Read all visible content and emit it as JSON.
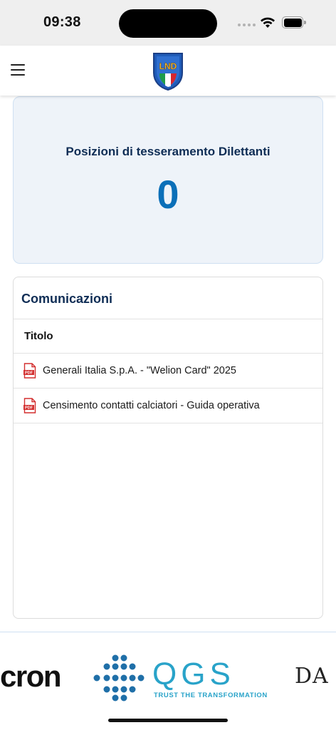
{
  "status_bar": {
    "time": "09:38"
  },
  "header": {
    "logo_text": "LND"
  },
  "stat_card": {
    "title": "Posizioni di tesseramento Dilettanti",
    "value": "0"
  },
  "communications": {
    "title": "Comunicazioni",
    "column_header": "Titolo",
    "items": [
      {
        "icon": "pdf-icon",
        "title": "Generali Italia S.p.A. - \"Welion Card\" 2025"
      },
      {
        "icon": "pdf-icon",
        "title": "Censimento contatti calciatori - Guida operativa"
      }
    ]
  },
  "sponsors": {
    "left_partial": "cron",
    "qgs_name": "QGS",
    "qgs_tagline": "TRUST THE TRANSFORMATION",
    "right_partial": "DA"
  },
  "colors": {
    "navy": "#0f2d55",
    "accent_blue": "#0b6fb8",
    "card_bg": "#eef3f9",
    "pdf_red": "#d32f2f",
    "qgs_cyan": "#29a3c9"
  }
}
